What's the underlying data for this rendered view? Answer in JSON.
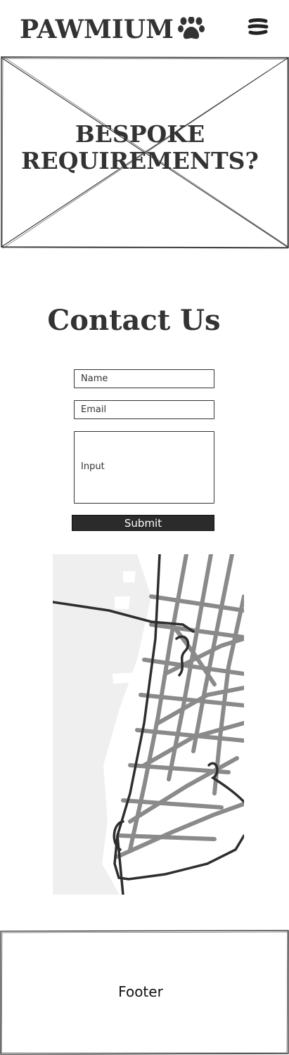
{
  "header": {
    "brand": "PAWMIUM",
    "logo_icon": "paw-icon",
    "menu_icon": "hamburger-menu-icon"
  },
  "hero": {
    "title_line1": "BESPOKE",
    "title_line2": "REQUIREMENTS?",
    "image": "placeholder-image"
  },
  "contact": {
    "title": "Contact Us",
    "name_placeholder": "Name",
    "email_placeholder": "Email",
    "message_placeholder": "Input",
    "submit_label": "Submit"
  },
  "map": {
    "icon": "map-image"
  },
  "footer": {
    "label": "Footer"
  },
  "colors": {
    "text": "#333333",
    "button_bg": "#2b2b2b",
    "map_bg": "#efefef",
    "road_major": "#2e2e2e",
    "road_minor": "#8a8a8a"
  }
}
